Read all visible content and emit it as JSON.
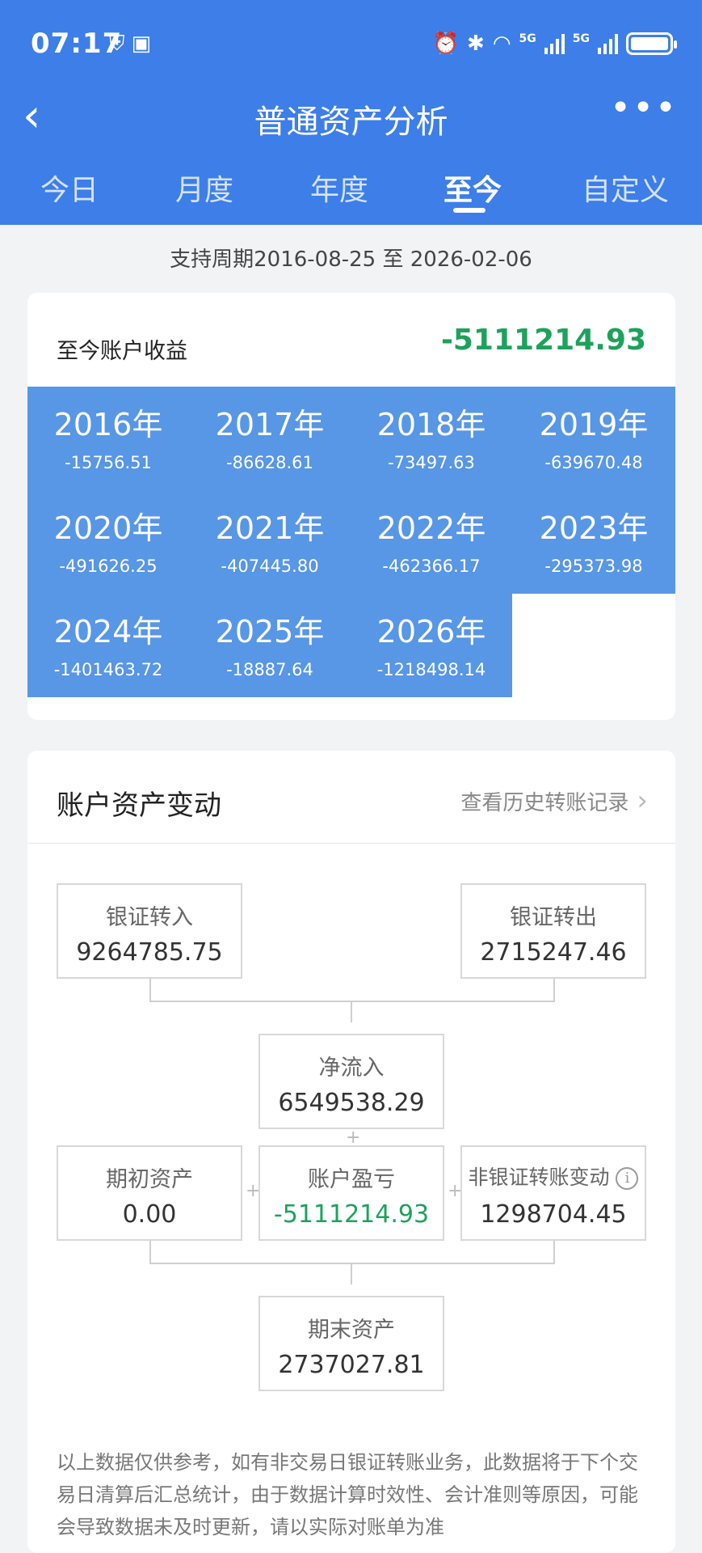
{
  "status_bar": {
    "time": "07:17",
    "network_badges": [
      "5G",
      "5G"
    ]
  },
  "nav": {
    "title": "普通资产分析",
    "more": "•••"
  },
  "tabs": [
    {
      "label": "今日"
    },
    {
      "label": "月度"
    },
    {
      "label": "年度"
    },
    {
      "label": "至今",
      "active": true
    },
    {
      "label": "自定义"
    }
  ],
  "period_text": "支持周期2016-08-25 至 2026-02-06",
  "earnings": {
    "label": "至今账户收益",
    "total": "-5111214.93",
    "years": [
      {
        "year": "2016年",
        "value": "-15756.51"
      },
      {
        "year": "2017年",
        "value": "-86628.61"
      },
      {
        "year": "2018年",
        "value": "-73497.63"
      },
      {
        "year": "2019年",
        "value": "-639670.48"
      },
      {
        "year": "2020年",
        "value": "-491626.25"
      },
      {
        "year": "2021年",
        "value": "-407445.80"
      },
      {
        "year": "2022年",
        "value": "-462366.17"
      },
      {
        "year": "2023年",
        "value": "-295373.98"
      },
      {
        "year": "2024年",
        "value": "-1401463.72"
      },
      {
        "year": "2025年",
        "value": "-18887.64"
      },
      {
        "year": "2026年",
        "value": "-1218498.14"
      }
    ]
  },
  "asset_change": {
    "title": "账户资产变动",
    "history_link": "查看历史转账记录",
    "transfer_in": {
      "label": "银证转入",
      "value": "9264785.75"
    },
    "transfer_out": {
      "label": "银证转出",
      "value": "2715247.46"
    },
    "net_inflow": {
      "label": "净流入",
      "value": "6549538.29"
    },
    "initial_assets": {
      "label": "期初资产",
      "value": "0.00"
    },
    "pnl": {
      "label": "账户盈亏",
      "value": "-5111214.93"
    },
    "non_bank_change": {
      "label": "非银证转账变动",
      "value": "1298704.45"
    },
    "ending_assets": {
      "label": "期末资产",
      "value": "2737027.81"
    },
    "plus": "+",
    "note": "以上数据仅供参考，如有非交易日银证转账业务，此数据将于下个交易日清算后汇总统计，由于数据计算时效性、会计准则等原因，可能会导致数据未及时更新，请以实际对账单为准"
  },
  "colors": {
    "header_blue": "#3d7ee8",
    "grid_blue": "#5896e6",
    "positive_green": "#1da25c"
  }
}
